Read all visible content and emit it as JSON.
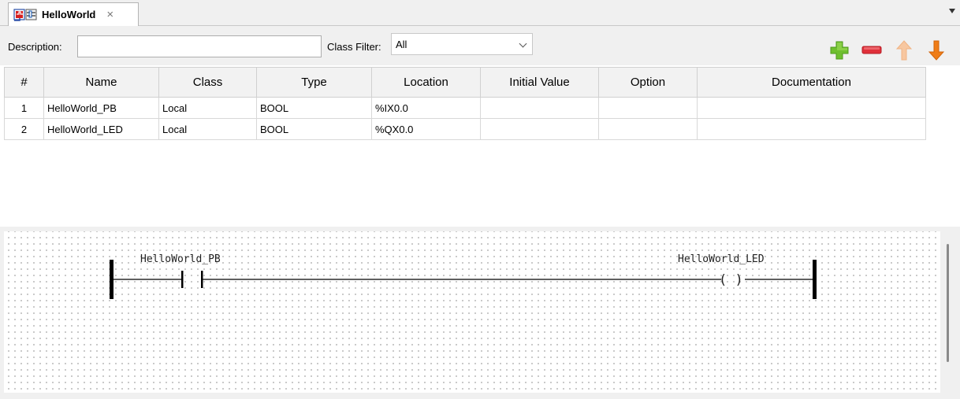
{
  "tab": {
    "title": "HelloWorld",
    "close_symbol": "×"
  },
  "filter": {
    "description_label": "Description:",
    "description_value": "",
    "class_filter_label": "Class Filter:",
    "class_filter_value": "All"
  },
  "toolbar": {
    "icons": [
      "add-icon",
      "remove-icon",
      "move-up-icon",
      "move-down-icon"
    ],
    "colors": {
      "add": "#6fbf2f",
      "remove": "#e0303a",
      "up": "#f7c7a0",
      "down": "#ef7d18"
    }
  },
  "table": {
    "columns": [
      "#",
      "Name",
      "Class",
      "Type",
      "Location",
      "Initial Value",
      "Option",
      "Documentation"
    ],
    "rows": [
      {
        "num": "1",
        "name": "HelloWorld_PB",
        "class": "Local",
        "type": "BOOL",
        "location": "%IX0.0",
        "initial_value": "",
        "option": "",
        "documentation": ""
      },
      {
        "num": "2",
        "name": "HelloWorld_LED",
        "class": "Local",
        "type": "BOOL",
        "location": "%QX0.0",
        "initial_value": "",
        "option": "",
        "documentation": ""
      }
    ]
  },
  "ladder": {
    "contact_label": "HelloWorld_PB",
    "coil_label": "HelloWorld_LED",
    "coil_symbol": "( )"
  }
}
